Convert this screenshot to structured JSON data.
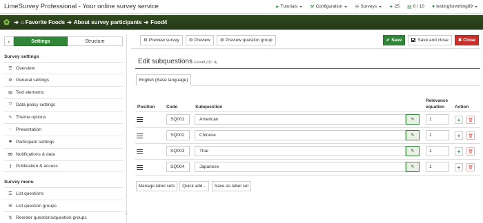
{
  "app": {
    "brand": "LimeSurvey Professional - Your online survey service"
  },
  "topnav": {
    "tutorials": "Tutorials",
    "configuration": "Configuration",
    "surveys": "Surveys",
    "responses_count": "25",
    "quota": "0 / 10",
    "user": "testingforwriting89"
  },
  "breadcrumb": {
    "survey": "Favorite Foods",
    "group": "About survey participants",
    "question": "Food4"
  },
  "sidebar": {
    "tab_settings": "Settings",
    "tab_structure": "Structure",
    "settings_title": "Survey settings",
    "settings_items": [
      {
        "label": "Overview",
        "icon": "list-icon"
      },
      {
        "label": "General settings",
        "icon": "gears-icon"
      },
      {
        "label": "Text elements",
        "icon": "file-text-icon"
      },
      {
        "label": "Data policy settings",
        "icon": "shield-icon"
      },
      {
        "label": "Theme options",
        "icon": "paint-brush-icon"
      },
      {
        "label": "Presentation",
        "icon": "eye-slash-icon"
      },
      {
        "label": "Participant settings",
        "icon": "users-icon"
      },
      {
        "label": "Notifications & data",
        "icon": "feed-icon"
      },
      {
        "label": "Publication & access",
        "icon": "key-icon"
      }
    ],
    "menu_title": "Survey menu",
    "menu_items": [
      {
        "label": "List questions",
        "icon": "list-icon"
      },
      {
        "label": "List question groups",
        "icon": "list-icon"
      },
      {
        "label": "Reorder questions/question groups",
        "icon": "icon-reorder"
      }
    ]
  },
  "toolbar": {
    "preview_survey": "Preview survey",
    "preview": "Preview",
    "preview_question_group": "Preview question group",
    "save": "Save",
    "save_and_close": "Save and close",
    "close": "Close"
  },
  "editor": {
    "title": "Edit subquestions",
    "subtitle": "Food4 (ID: 4)",
    "language_tab": "English (Base language)",
    "headers": {
      "position": "Position",
      "code": "Code",
      "subquestion": "Subquestion",
      "relevance_line1": "Relevance",
      "relevance_line2": "equation",
      "action": "Action"
    },
    "rows": [
      {
        "code": "SQ001",
        "subquestion": "American",
        "relevance": "1"
      },
      {
        "code": "SQ002",
        "subquestion": "Chinese",
        "relevance": "1"
      },
      {
        "code": "SQ003",
        "subquestion": "Thai",
        "relevance": "1"
      },
      {
        "code": "SQ004",
        "subquestion": "Japanese",
        "relevance": "1"
      }
    ],
    "bottom_buttons": {
      "manage_label_sets": "Manage label sets",
      "quick_add": "Quick add...",
      "save_as_label_set": "Save as label set"
    }
  },
  "colors": {
    "brand_green": "#328637",
    "close_red": "#c9302c",
    "breadcrumb_bg": "#2f4a1c"
  }
}
